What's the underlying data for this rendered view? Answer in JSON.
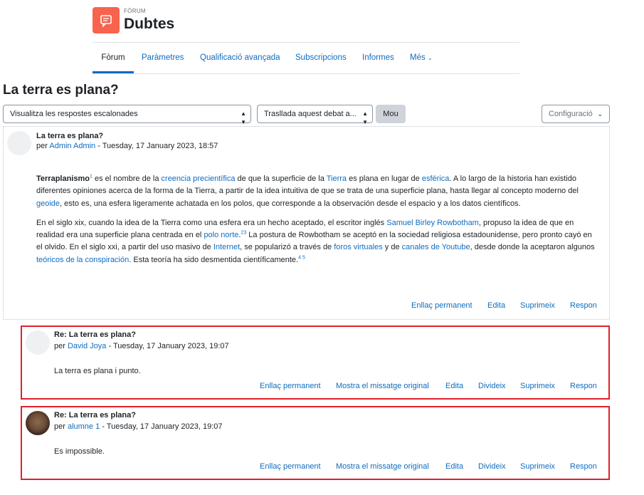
{
  "header": {
    "kicker": "FÒRUM",
    "title": "Dubtes",
    "icon": "forum-icon"
  },
  "nav": {
    "tabs": [
      "Fòrum",
      "Paràmetres",
      "Qualificació avançada",
      "Subscripcions",
      "Informes",
      "Més"
    ],
    "active": "Fòrum"
  },
  "page_title": "La terra es plana?",
  "controls": {
    "display_mode": "Visualitza les respostes escalonades",
    "move_select": "Trasllada aquest debat a...",
    "move_button": "Mou",
    "settings_button": "Configuració"
  },
  "main_post": {
    "subject": "La terra es plana?",
    "by": "per",
    "author": "Admin Admin",
    "date": " - Tuesday, 17 January 2023, 18:57",
    "p1": {
      "term": "Terraplanismo",
      "sup1": "1",
      "t1": " es el nombre de la ",
      "l1": "creencia precientífica",
      "t2": " de que la superficie de la ",
      "l2": "Tierra",
      "t3": " es plana en lugar de ",
      "l3": "esférica",
      "t4": ". A lo largo de la historia han existido diferentes opiniones acerca de la forma de la Tierra, a partir de la idea intuitiva de que se trata de una superficie plana, hasta llegar al concepto moderno del ",
      "l4": "geoide",
      "t5": ", esto es, una esfera ligeramente achatada en los polos, que corresponde a la observación desde el espacio y a los datos científicos."
    },
    "p2": {
      "t1": "En el siglo xix, cuando la idea de la Tierra como una esfera era un hecho aceptado, el escritor inglés ",
      "l1": "Samuel Birley Rowbotham",
      "t2": ", propuso la idea de que en realidad era una superficie plana centrada en el ",
      "l2": "polo norte",
      "t3": ".",
      "sup1": "23",
      "t4": " La postura de Rowbotham se aceptó en la sociedad religiosa estadounidense, pero pronto cayó en el olvido. En el siglo xxi, a partir del uso masivo de ",
      "l3": "Internet",
      "t5": ", se popularizó a través de ",
      "l4": "foros virtuales",
      "t6": " y de ",
      "l5": "canales de Youtube",
      "t7": ", desde donde la aceptaron algunos ",
      "l6": "teóricos de la conspiración",
      "t8": ". Esta teoría ha sido desmentida científicamente.",
      "sup2": "4 5"
    },
    "actions": [
      "Enllaç permanent",
      "Edita",
      "Suprimeix",
      "Respon"
    ]
  },
  "replies": [
    {
      "subject": "Re: La terra es plana?",
      "by": "per",
      "author": "David Joya",
      "date": " - Tuesday, 17 January 2023, 19:07",
      "body": "La terra es plana i punto.",
      "actions": [
        "Enllaç permanent",
        "Mostra el missatge original",
        "Edita",
        "Divideix",
        "Suprimeix",
        "Respon"
      ]
    },
    {
      "subject": "Re: La terra es plana?",
      "by": "per",
      "author": "alumne 1",
      "date": " - Tuesday, 17 January 2023, 19:07",
      "body": "Es impossible.",
      "actions": [
        "Enllaç permanent",
        "Mostra el missatge original",
        "Edita",
        "Divideix",
        "Suprimeix",
        "Respon"
      ]
    }
  ],
  "colors": {
    "accent": "#0f6cbf",
    "forum_icon": "#f7634d",
    "highlight_border": "#e0202e"
  }
}
